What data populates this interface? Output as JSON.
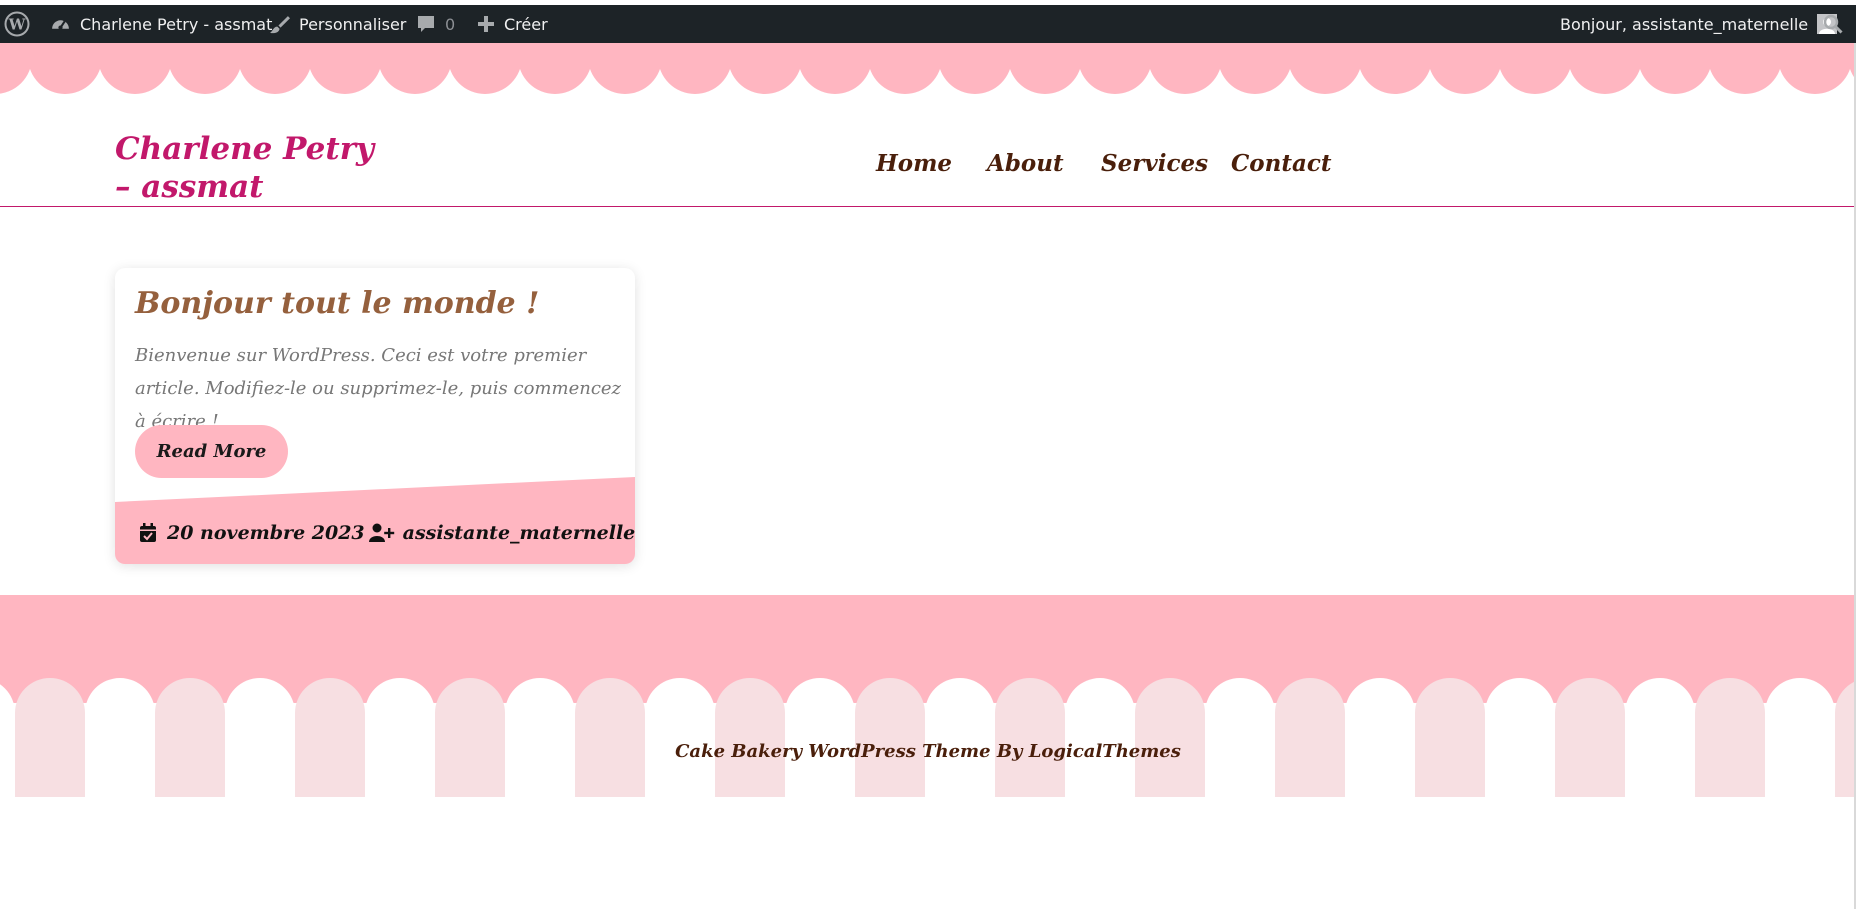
{
  "adminbar": {
    "wp_logo_icon": "wordpress-logo-icon",
    "site_name": "Charlene Petry - assmat",
    "customize_label": "Personnaliser",
    "comments_count": "0",
    "new_label": "Créer",
    "greeting": "Bonjour, assistante_maternelle",
    "search_icon": "search-icon"
  },
  "header": {
    "site_title": "Charlene Petry – assmat",
    "nav": [
      "Home",
      "About",
      "Services",
      "Contact"
    ]
  },
  "post": {
    "title": "Bonjour tout le monde !",
    "excerpt": "Bienvenue sur WordPress. Ceci est votre premier article. Modifiez-le ou supprimez-le, puis commencez à écrire !",
    "read_more": "Read More",
    "date": "20 novembre 2023",
    "author": "assistante_maternelle"
  },
  "footer": {
    "credit": "Cake Bakery WordPress Theme By LogicalThemes"
  },
  "colors": {
    "adminbar_bg": "#1d2327",
    "pink": "#ffb6c1",
    "pink_light": "#f7dfe2",
    "title_magenta": "#c2186b",
    "nav_brown": "#4a1f0b",
    "post_title_brown": "#95603d"
  }
}
